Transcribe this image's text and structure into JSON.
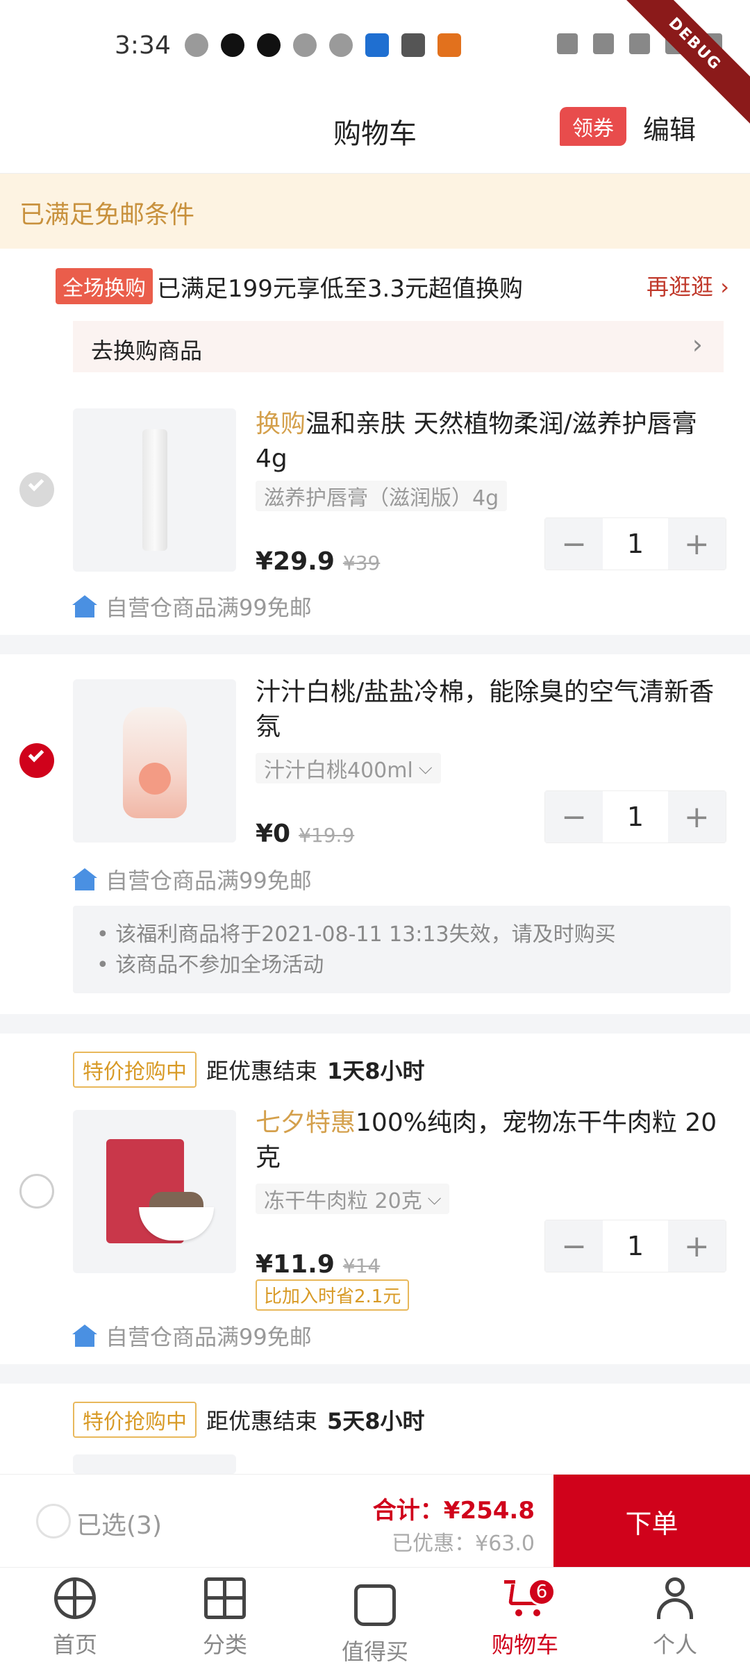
{
  "status_bar": {
    "time": "3:34"
  },
  "debug_label": "DEBUG",
  "header": {
    "title": "购物车",
    "coupon_label": "领券",
    "edit_label": "编辑"
  },
  "free_shipping": {
    "text": "已满足免邮条件"
  },
  "promo": {
    "badge": "全场换购",
    "text": "已满足199元享低至3.3元超值换购",
    "more_label": "再逛逛",
    "exchange_label": "去换购商品"
  },
  "items": [
    {
      "title_highlight": "换购",
      "title": "温和亲肤 天然植物柔润/滋养护唇膏4g",
      "spec": "滋养护唇膏（滋润版）4g",
      "price": "¥29.9",
      "old_price": "¥39",
      "quantity": "1",
      "shipping": "自营仓商品满99免邮",
      "checked": "disabled"
    },
    {
      "title": "汁汁白桃/盐盐冷棉，能除臭的空气清新香氛",
      "spec": "汁汁白桃400ml",
      "price": "¥0",
      "old_price": "¥19.9",
      "quantity": "1",
      "shipping": "自营仓商品满99免邮",
      "checked": "on",
      "notice": [
        "• 该福利商品将于2021-08-11 13:13失效，请及时购买",
        "• 该商品不参加全场活动"
      ]
    },
    {
      "flash_tag": "特价抢购中",
      "flash_label": "距优惠结束",
      "flash_time": "1天8小时",
      "title_highlight": "七夕特惠",
      "title": "100%纯肉，宠物冻干牛肉粒 20克",
      "spec": "冻干牛肉粒 20克",
      "price": "¥11.9",
      "old_price": "¥14",
      "save_tag": "比加入时省2.1元",
      "quantity": "1",
      "shipping": "自营仓商品满99免邮",
      "checked": "off"
    },
    {
      "flash_tag": "特价抢购中",
      "flash_label": "距优惠结束",
      "flash_time": "5天8小时"
    }
  ],
  "bottom_bar": {
    "selected_label": "已选(3)",
    "total": "合计：¥254.8",
    "discount": "已优惠：¥63.0",
    "order_label": "下单"
  },
  "tab_bar": {
    "tabs": [
      {
        "label": "首页",
        "icon": "home-icon"
      },
      {
        "label": "分类",
        "icon": "category-icon"
      },
      {
        "label": "值得买",
        "icon": "thumbs-up-icon"
      },
      {
        "label": "购物车",
        "icon": "cart-icon",
        "active": true
      },
      {
        "label": "个人",
        "icon": "user-icon"
      }
    ],
    "cart_badge": "6"
  },
  "colors": {
    "accent": "#d0021b",
    "gold": "#d4a04c",
    "free_ship_bg": "#fdf3e2"
  }
}
